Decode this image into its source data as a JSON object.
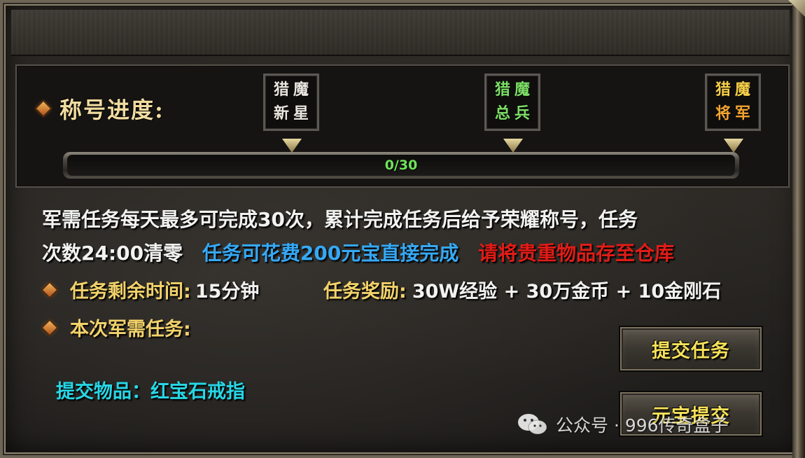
{
  "progress": {
    "label": "称号进度:",
    "titles": [
      {
        "line1": "猎魔",
        "line2": "新星",
        "color": "#e9e6df"
      },
      {
        "line1": "猎魔",
        "line2": "总兵",
        "color": "#7cdf66"
      },
      {
        "line1": "猎魔",
        "line2": "将军",
        "color": "#f5a531"
      }
    ],
    "current": 0,
    "max": 30,
    "text": "0/30"
  },
  "description": {
    "line1": "军需任务每天最多可完成30次，累计完成任务后给予荣耀称号，任务",
    "line2_white": "次数24:00清零",
    "line2_blue": "任务可花费200元宝直接完成",
    "line2_red": "请将贵重物品存至仓库"
  },
  "info": {
    "remaining_label": "任务剩余时间:",
    "remaining_value": "15分钟",
    "reward_label": "任务奖励:",
    "reward_value": "30W经验 + 30万金币 + 10金刚石",
    "current_task_label": "本次军需任务:"
  },
  "submit_item": {
    "text": "提交物品：红宝石戒指"
  },
  "buttons": {
    "submit": "提交任务",
    "ingot_submit": "元宝提交"
  },
  "watermark": {
    "text": "公众号 · 996传奇盒子",
    "icon": "wechat-icon"
  },
  "colors": {
    "gold": "#f2d26a",
    "blue": "#36a8f4",
    "red": "#e11c17",
    "cyan": "#27d7e6",
    "button_text": "#f6e15a"
  }
}
